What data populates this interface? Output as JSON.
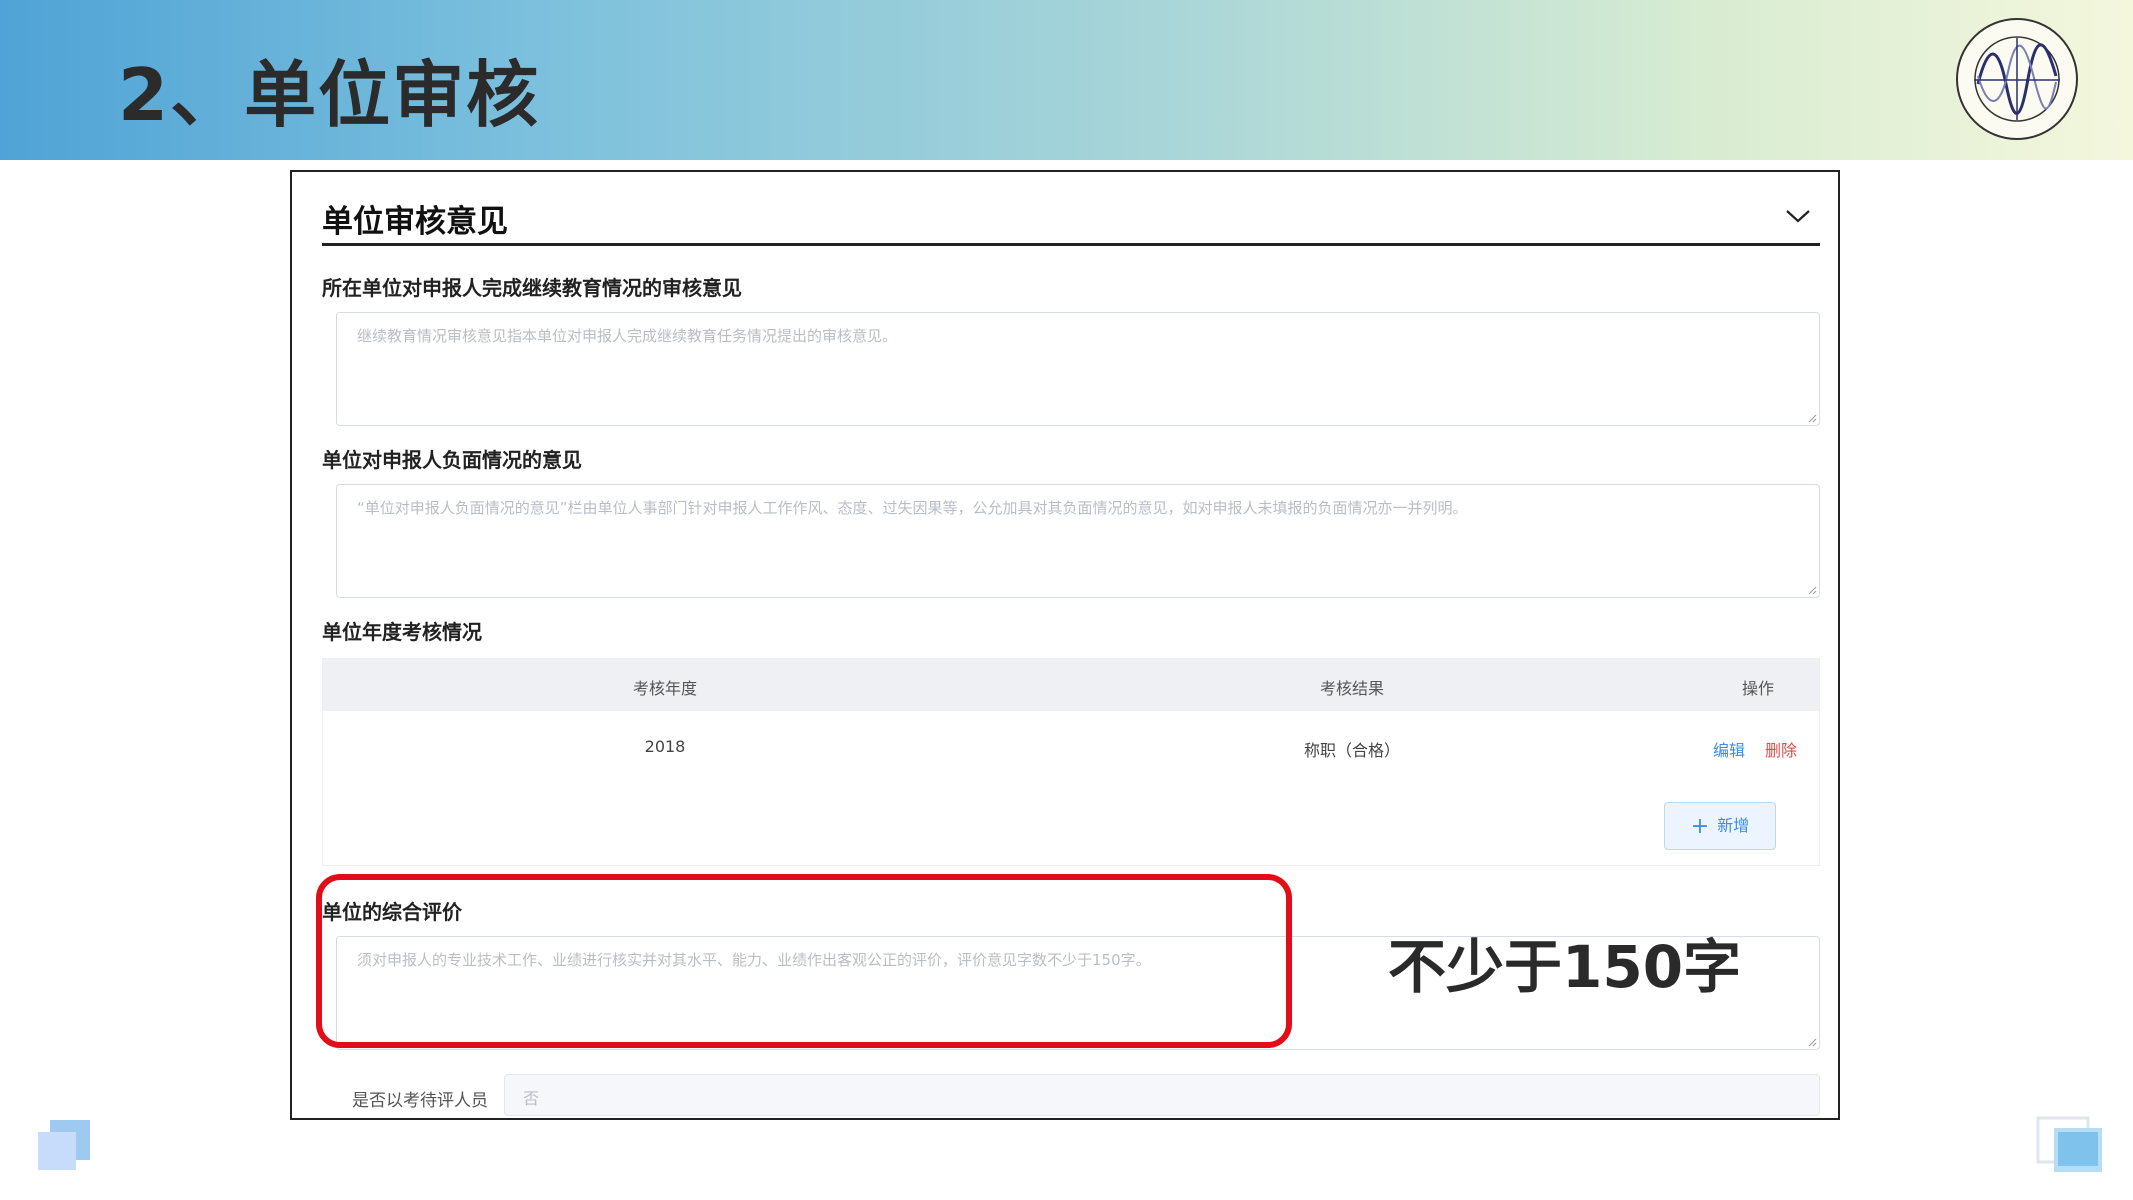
{
  "slide": {
    "title": "2、单位审核",
    "callout": "不少于150字"
  },
  "panel": {
    "title": "单位审核意见",
    "toggle_icon": "chevron-down-icon"
  },
  "fields": {
    "continuing_education": {
      "label": "所在单位对申报人完成继续教育情况的审核意见",
      "placeholder": "继续教育情况审核意见指本单位对申报人完成继续教育任务情况提出的审核意见。"
    },
    "negative_situation": {
      "label": "单位对申报人负面情况的意见",
      "placeholder": "“单位对申报人负面情况的意见”栏由单位人事部门针对申报人工作作风、态度、过失因果等，公允加具对其负面情况的意见，如对申报人未填报的负面情况亦一并列明。"
    },
    "annual_assessment": {
      "label": "单位年度考核情况",
      "columns": [
        "考核年度",
        "考核结果",
        "操作"
      ],
      "rows": [
        {
          "year": "2018",
          "result": "称职（合格）",
          "edit": "编辑",
          "delete": "删除"
        }
      ],
      "add_button": "新增"
    },
    "overall_evaluation": {
      "label": "单位的综合评价",
      "placeholder": "须对申报人的专业技术工作、业绩进行核实并对其水平、能力、业绩作出客观公正的评价，评价意见字数不少于150字。"
    },
    "pending_evaluation": {
      "label": "是否以考待评人员",
      "value": "否"
    }
  },
  "colors": {
    "highlight": "#e30d17",
    "link": "#3a8ee6",
    "danger": "#e04a4a"
  }
}
